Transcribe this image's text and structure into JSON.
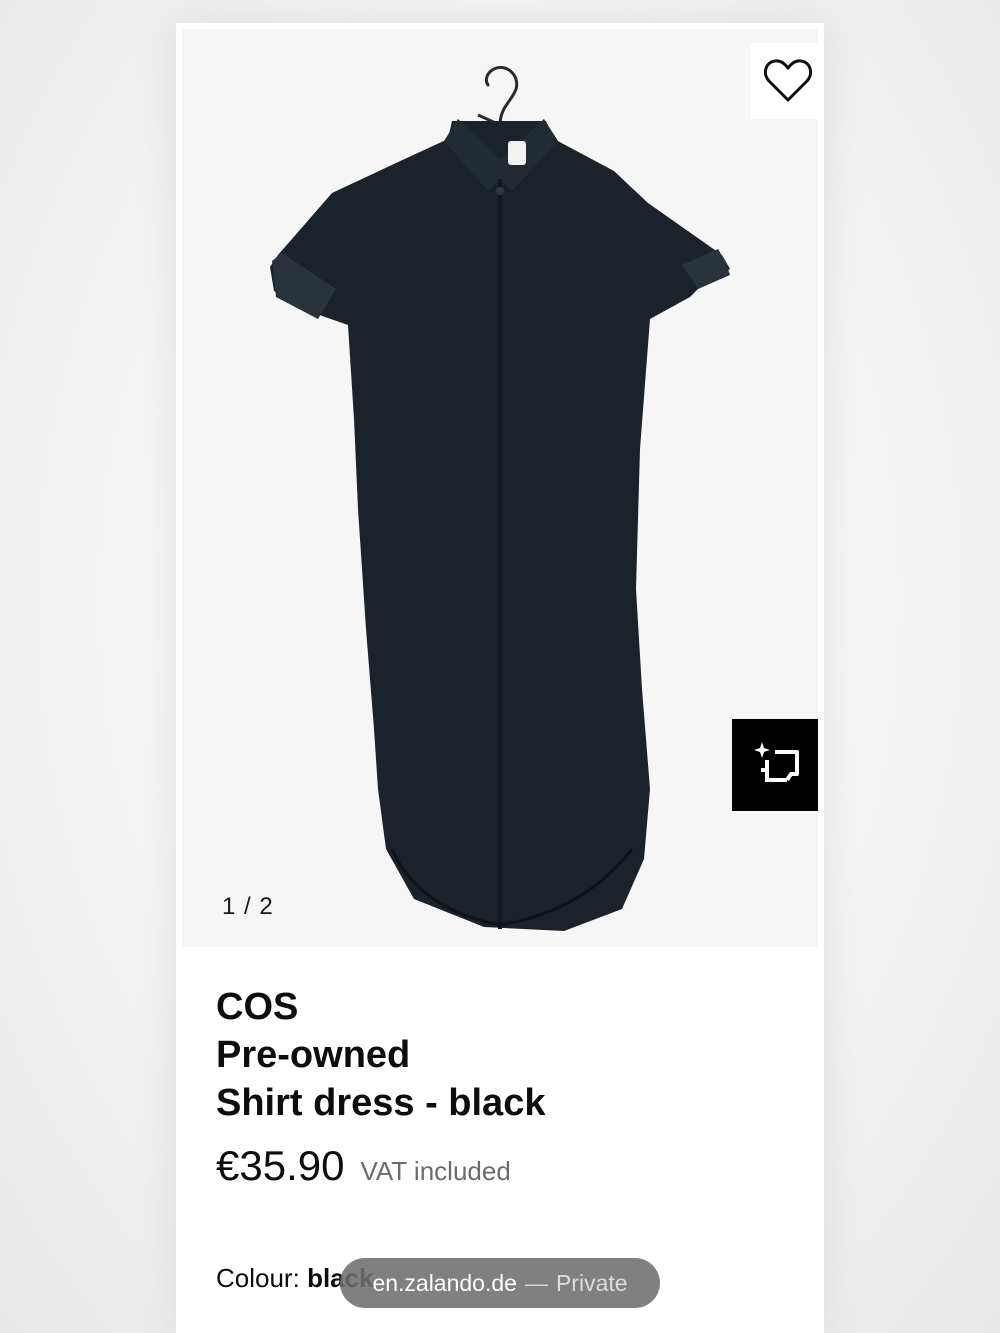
{
  "gallery": {
    "pager": "1 / 2",
    "wishlist_icon": "heart-outline-icon",
    "find_similar_icon": "sparkle-crop-icon",
    "image_description_color": "#1b222a"
  },
  "product": {
    "brand": "COS",
    "condition": "Pre-owned",
    "name": "Shirt dress - black",
    "price": "€35.90",
    "vat": "VAT included",
    "colour_label": "Colour:",
    "colour_value": "black"
  },
  "browser": {
    "domain": "en.zalando.de",
    "separator": "—",
    "mode": "Private"
  },
  "colors": {
    "accent": "#000000",
    "muted_text": "#6b6b6b"
  }
}
